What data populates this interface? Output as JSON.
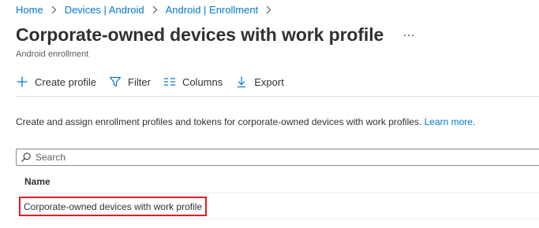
{
  "breadcrumb": {
    "items": [
      {
        "label": "Home"
      },
      {
        "label": "Devices | Android"
      },
      {
        "label": "Android | Enrollment"
      }
    ]
  },
  "header": {
    "title": "Corporate-owned devices with work profile",
    "subtitle": "Android enrollment",
    "more_icon": "ellipsis-icon"
  },
  "toolbar": {
    "create_label": "Create profile",
    "filter_label": "Filter",
    "columns_label": "Columns",
    "export_label": "Export"
  },
  "description": {
    "text": "Create and assign enrollment profiles and tokens for corporate-owned devices with work profiles.",
    "link": "Learn more."
  },
  "search": {
    "placeholder": "Search",
    "value": ""
  },
  "table": {
    "columns": [
      "Name"
    ],
    "rows": [
      {
        "name": "Corporate-owned devices with work profile"
      }
    ]
  },
  "colors": {
    "accent": "#0078d4",
    "highlight_border": "#e31c23",
    "text": "#323130",
    "muted": "#605e5c"
  }
}
